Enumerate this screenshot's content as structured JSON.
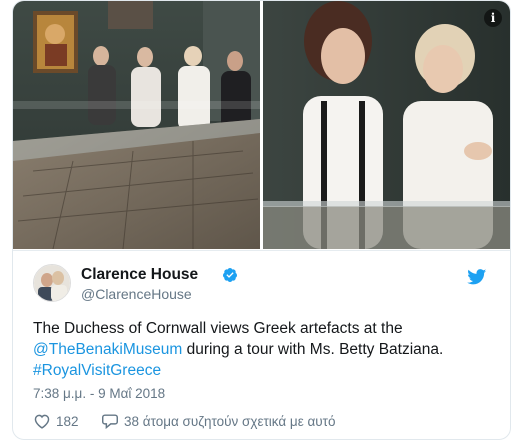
{
  "media": {
    "left_alt": "Photo in museum with people looking at a mosaic display case",
    "right_alt": "Two women viewing artefacts in a glass case"
  },
  "author": {
    "display_name": "Clarence House",
    "handle": "@ClarenceHouse",
    "verified": true
  },
  "tweet": {
    "line1": "The Duchess of Cornwall views Greek artefacts at the",
    "mention": "@TheBenakiMuseum",
    "line2_rest": " during a tour with Ms. Betty Batziana.",
    "hashtag": "#RoyalVisitGreece"
  },
  "timestamp": "7:38 μ.μ. - 9 Μαΐ 2018",
  "actions": {
    "likes": "182",
    "talking": "38 άτομα συζητούν σχετικά με αυτό"
  },
  "colors": {
    "link": "#1b95e0",
    "text": "#14171a",
    "muted": "#657786",
    "verified": "#1da1f2"
  }
}
